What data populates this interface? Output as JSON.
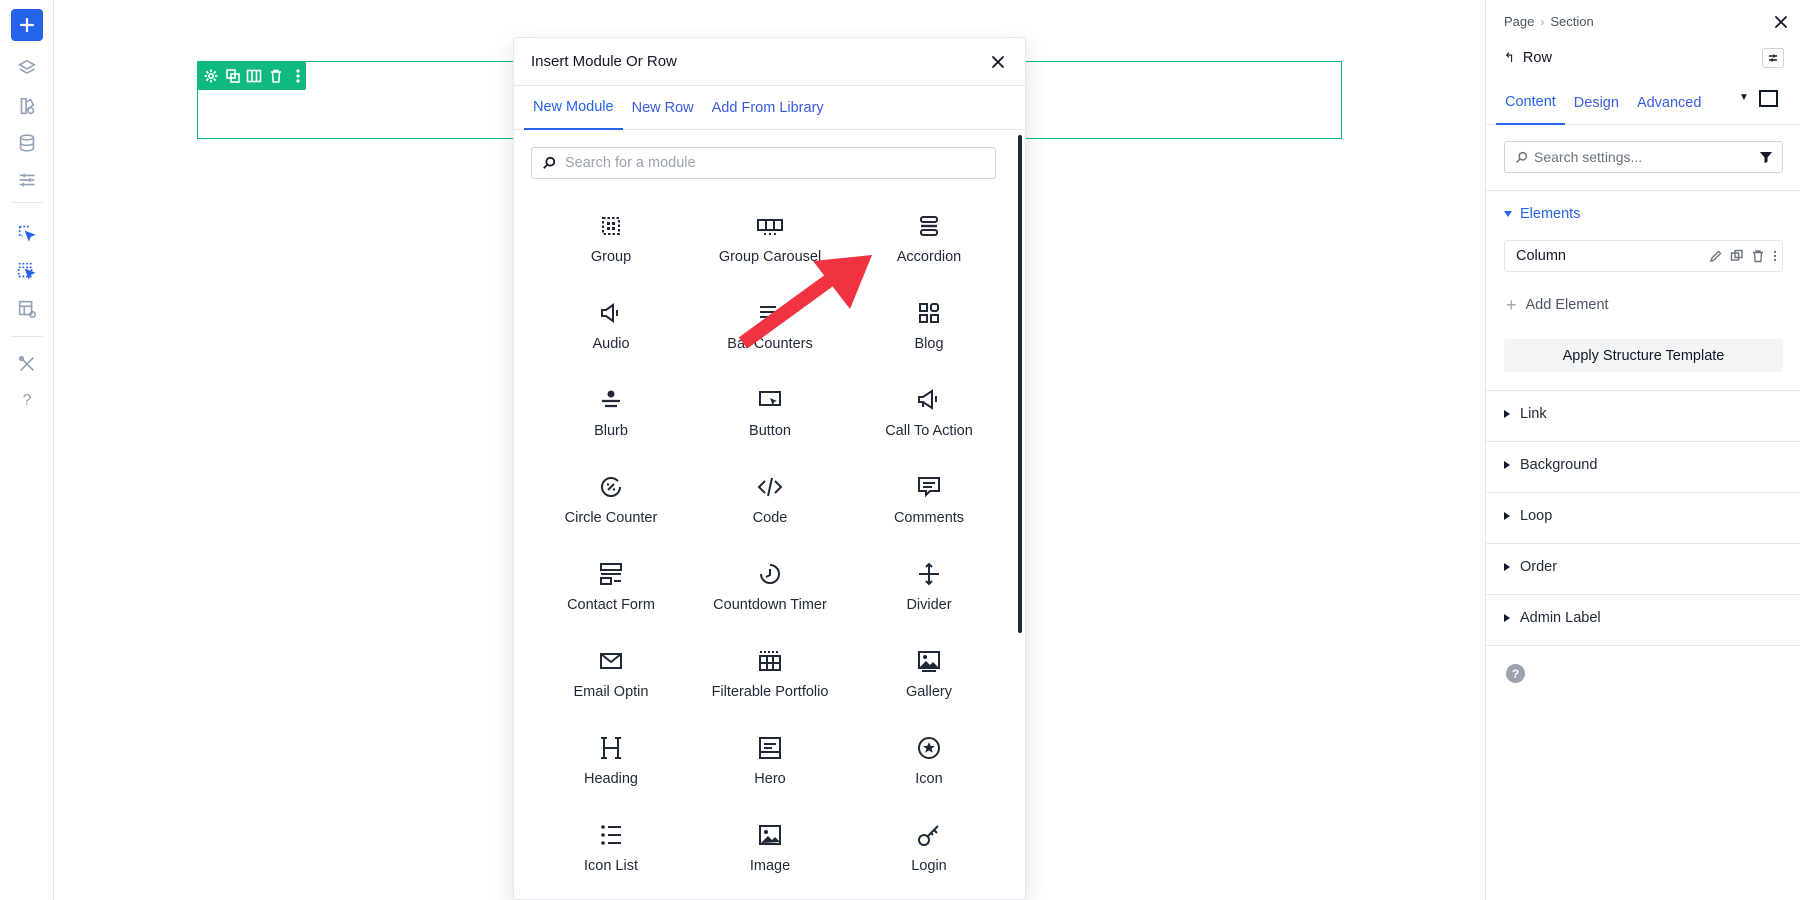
{
  "rail": {
    "items": [
      "add",
      "layers-icon",
      "pages-icon",
      "database-icon",
      "settings-sliders-icon",
      "select-cursor-icon",
      "multi-select-icon",
      "preview-layout-icon",
      "tools-icon",
      "help"
    ],
    "help_label": "?"
  },
  "modal": {
    "title": "Insert Module Or Row",
    "tabs": [
      {
        "label": "New Module",
        "active": true
      },
      {
        "label": "New Row",
        "active": false
      },
      {
        "label": "Add From Library",
        "active": false
      }
    ],
    "search_placeholder": "Search for a module",
    "modules": [
      {
        "label": "Group",
        "icon": "group-icon"
      },
      {
        "label": "Group Carousel",
        "icon": "group-carousel-icon"
      },
      {
        "label": "Accordion",
        "icon": "accordion-icon"
      },
      {
        "label": "Audio",
        "icon": "audio-icon"
      },
      {
        "label": "Bar Counters",
        "icon": "bar-counters-icon"
      },
      {
        "label": "Blog",
        "icon": "blog-icon"
      },
      {
        "label": "Blurb",
        "icon": "blurb-icon"
      },
      {
        "label": "Button",
        "icon": "button-icon"
      },
      {
        "label": "Call To Action",
        "icon": "call-to-action-icon"
      },
      {
        "label": "Circle Counter",
        "icon": "circle-counter-icon"
      },
      {
        "label": "Code",
        "icon": "code-icon"
      },
      {
        "label": "Comments",
        "icon": "comments-icon"
      },
      {
        "label": "Contact Form",
        "icon": "contact-form-icon"
      },
      {
        "label": "Countdown Timer",
        "icon": "countdown-timer-icon"
      },
      {
        "label": "Divider",
        "icon": "divider-icon"
      },
      {
        "label": "Email Optin",
        "icon": "email-optin-icon"
      },
      {
        "label": "Filterable Portfolio",
        "icon": "filterable-portfolio-icon"
      },
      {
        "label": "Gallery",
        "icon": "gallery-icon"
      },
      {
        "label": "Heading",
        "icon": "heading-icon"
      },
      {
        "label": "Hero",
        "icon": "hero-icon"
      },
      {
        "label": "Icon",
        "icon": "icon-module-icon"
      },
      {
        "label": "Icon List",
        "icon": "icon-list-icon"
      },
      {
        "label": "Image",
        "icon": "image-icon"
      },
      {
        "label": "Login",
        "icon": "login-icon"
      }
    ]
  },
  "panel": {
    "breadcrumb": [
      "Page",
      "Section"
    ],
    "element_title": "Row",
    "tabs": [
      {
        "label": "Content",
        "active": true
      },
      {
        "label": "Design",
        "active": false
      },
      {
        "label": "Advanced",
        "active": false
      }
    ],
    "search_placeholder": "Search settings...",
    "elements_heading": "Elements",
    "column_label": "Column",
    "add_element_label": "Add Element",
    "apply_template_label": "Apply Structure Template",
    "sections": [
      "Link",
      "Background",
      "Loop",
      "Order",
      "Admin Label"
    ],
    "help_label": "?"
  },
  "colors": {
    "accent": "#2563eb",
    "row_outline": "#10b981",
    "arrow": "#ef3340"
  }
}
